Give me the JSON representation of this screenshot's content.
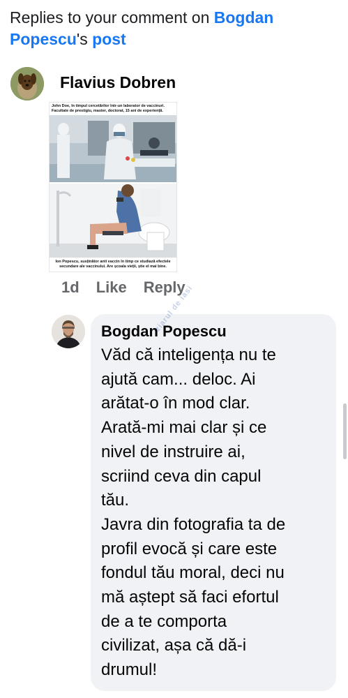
{
  "header": {
    "prefix": "Replies to your comment on ",
    "owner_name": "Bogdan Popescu",
    "possessive": "'s ",
    "post_link": "post"
  },
  "comment": {
    "author": "Flavius Dobren",
    "meme": {
      "top_caption": "John Doe, în timpul cercetărilor într-un laborator de vaccinuri. Facultate de prestigiu, master, doctorat, 15 ani de experiență.",
      "bottom_caption": "Ion Popescu, susținător anti vaccin în timp ce studiază efectele secundare ale vaccinului. Are școala vieții, știe el mai bine."
    },
    "time": "1d",
    "like_label": "Like",
    "reply_label": "Reply"
  },
  "reply": {
    "author": "Bogdan Popescu",
    "text": "Văd că inteligența nu te\najută cam... deloc. Ai\narătat-o în mod clar.\nArată-mi mai clar și ce\nnivel de instruire ai,\nscriind ceva din capul\ntău.\nJavra din fotografia ta de\nprofil evocă și care este\nfondul tău moral, deci nu\nmă aștept să faci efortul\nde a te comporta\ncivilizat, așa că dă-i\ndrumul!"
  },
  "watermark": "ziarul de iasi",
  "colors": {
    "link": "#1877f2",
    "meta": "#65676b",
    "bubble": "#f0f2f5"
  }
}
